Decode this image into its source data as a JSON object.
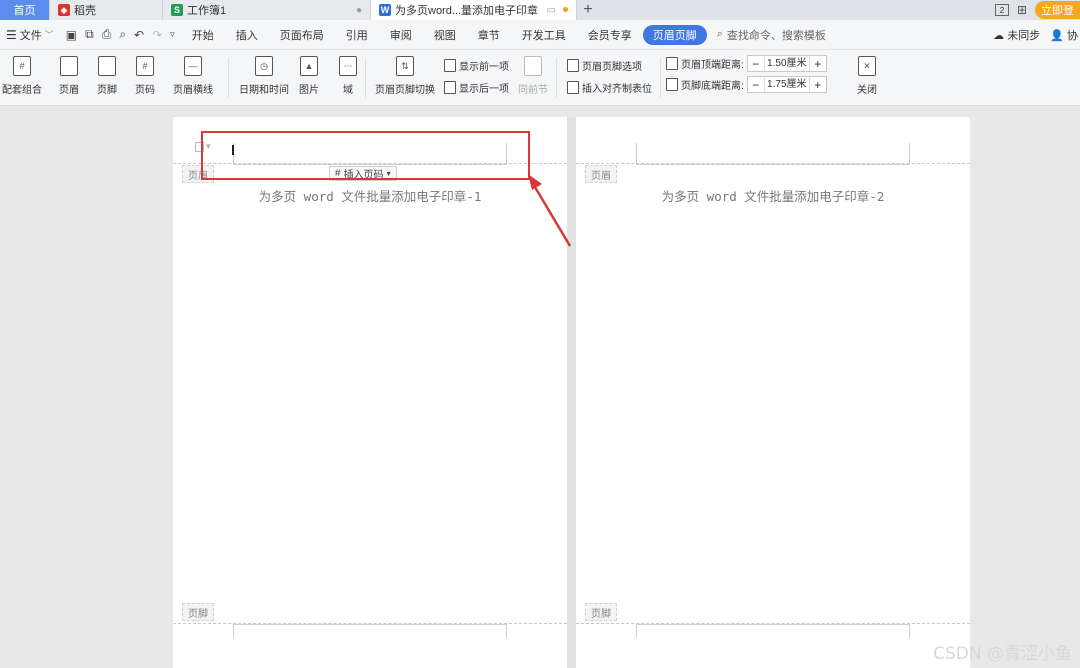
{
  "tabs": {
    "home": "首页",
    "daoke": "稻壳",
    "workbook": "工作簿1",
    "document": "为多页word...量添加电子印章",
    "new_tab": "+"
  },
  "tabbar_right": {
    "badge": "2",
    "login": "立即登"
  },
  "menubar": {
    "file": "文件",
    "items": [
      "开始",
      "插入",
      "页面布局",
      "引用",
      "审阅",
      "视图",
      "章节",
      "开发工具",
      "会员专享"
    ],
    "active": "页眉页脚",
    "search": "查找命令、搜索模板",
    "sync": "未同步",
    "collab": "协"
  },
  "ribbon": {
    "peitao": "配套组合",
    "header": "页眉",
    "footer": "页脚",
    "pagenum": "页码",
    "header_line": "页眉横线",
    "datetime": "日期和时间",
    "picture": "图片",
    "field": "域",
    "hf_switch": "页眉页脚切换",
    "show_prev": "显示前一项",
    "show_next": "显示后一项",
    "same_prev": "同前节",
    "hf_options": "页眉页脚选项",
    "insert_align": "插入对齐制表位",
    "top_dist_label": "页眉顶端距离:",
    "top_dist_value": "1.50厘米",
    "bottom_dist_label": "页脚底端距离:",
    "bottom_dist_value": "1.75厘米",
    "close": "关闭"
  },
  "pages": {
    "header_label": "页眉",
    "footer_label": "页脚",
    "insert_page_number": "插入页码",
    "page1_text": "为多页 word 文件批量添加电子印章-1",
    "page2_text": "为多页 word 文件批量添加电子印章-2"
  },
  "watermark": "CSDN @青涩小鱼",
  "colors": {
    "accent": "#3f78e0",
    "highlight": "#d93838",
    "home_tab": "#5b8def"
  }
}
